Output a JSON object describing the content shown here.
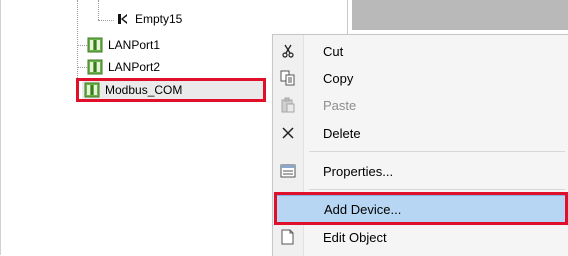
{
  "tree": {
    "items": [
      {
        "label": "Empty15",
        "icon": "empty-slot-icon"
      },
      {
        "label": "LANPort1",
        "icon": "device-icon"
      },
      {
        "label": "LANPort2",
        "icon": "device-icon"
      },
      {
        "label": "Modbus_COM",
        "icon": "device-icon"
      }
    ]
  },
  "context_menu": {
    "items": [
      {
        "label": "Cut",
        "icon": "scissors-icon",
        "enabled": true
      },
      {
        "label": "Copy",
        "icon": "copy-icon",
        "enabled": true
      },
      {
        "label": "Paste",
        "icon": "paste-icon",
        "enabled": false
      },
      {
        "label": "Delete",
        "icon": "delete-icon",
        "enabled": true
      },
      {
        "label": "Properties...",
        "icon": "properties-icon",
        "enabled": true
      },
      {
        "label": "Add Device...",
        "icon": "add-device-icon",
        "enabled": true,
        "selected": true
      },
      {
        "label": "Edit Object",
        "icon": "edit-object-icon",
        "enabled": true
      }
    ]
  },
  "colors": {
    "highlight_red": "#e0102a",
    "selection_blue": "#b6d6f3",
    "device_green": "#5aa03a"
  }
}
